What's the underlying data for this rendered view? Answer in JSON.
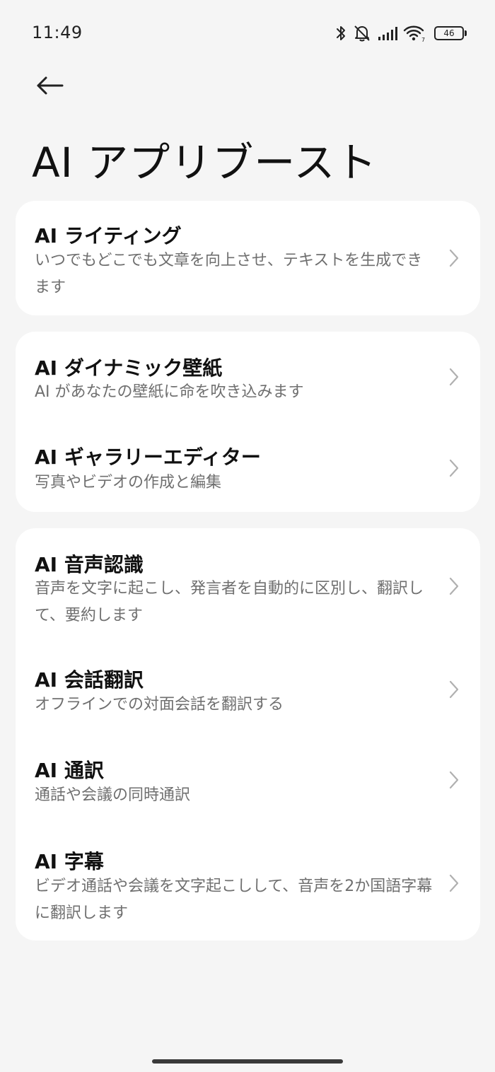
{
  "status_bar": {
    "time": "11:49",
    "battery": "46",
    "icons": [
      "bluetooth-icon",
      "mute-icon",
      "signal-icon",
      "wifi-icon",
      "battery-icon"
    ]
  },
  "header": {
    "back_icon": "arrow-left-icon",
    "title": "AI アプリブースト"
  },
  "cards": [
    {
      "items": [
        {
          "title": "AI ライティング",
          "description": "いつでもどこでも文章を向上させ、テキストを生成できます"
        }
      ]
    },
    {
      "items": [
        {
          "title": "AI ダイナミック壁紙",
          "description": "AI があなたの壁紙に命を吹き込みます"
        },
        {
          "title": "AI ギャラリーエディター",
          "description": "写真やビデオの作成と編集"
        }
      ]
    },
    {
      "items": [
        {
          "title": "AI 音声認識",
          "description": "音声を文字に起こし、発言者を自動的に区別し、翻訳して、要約します"
        },
        {
          "title": "AI 会話翻訳",
          "description": "オフラインでの対面会話を翻訳する"
        },
        {
          "title": "AI 通訳",
          "description": "通話や会議の同時通訳"
        },
        {
          "title": "AI 字幕",
          "description": "ビデオ通話や会議を文字起こしして、音声を2か国語字幕に翻訳します"
        }
      ]
    }
  ],
  "colors": {
    "background": "#f5f5f5",
    "card": "#ffffff",
    "title_text": "#111111",
    "description_text": "#6f6f6f",
    "chevron": "#b0b0b0"
  }
}
